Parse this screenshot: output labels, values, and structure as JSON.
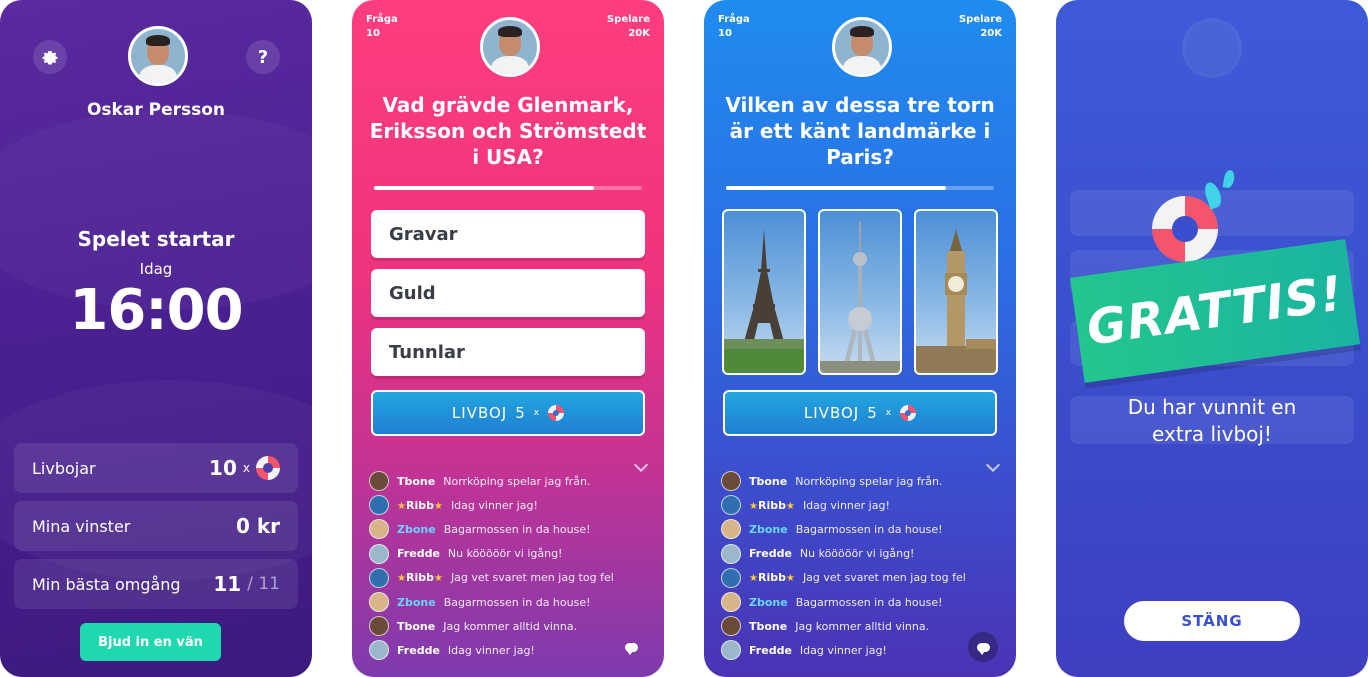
{
  "screen1": {
    "user_name": "Oskar Persson",
    "settings_icon": "gear-icon",
    "help_label": "?",
    "start_label": "Spelet startar",
    "day_label": "Idag",
    "time": "16:00",
    "stats": [
      {
        "label": "Livbojar",
        "value": "10",
        "suffix": "x"
      },
      {
        "label": "Mina vinster",
        "value": "0 kr"
      },
      {
        "label": "Min bästa omgång",
        "value": "11",
        "total": "/ 11"
      }
    ],
    "invite_label": "Bjud in en vän"
  },
  "quiz": {
    "question_label": "Fråga",
    "question_number": "10",
    "players_label": "Spelare",
    "players_count": "20K",
    "lifeline_label": "LIVBOJ",
    "lifeline_count": "5",
    "lifeline_x": "x"
  },
  "screen2": {
    "question": "Vad grävde Glenmark, Eriksson och Strömstedt i USA?",
    "progress": 0.82,
    "answers": [
      "Gravar",
      "Guld",
      "Tunnlar"
    ]
  },
  "screen3": {
    "question": "Vilken av dessa tre torn är ett känt landmärke i Paris?",
    "progress": 0.82,
    "photos": [
      "eiffel-tower-photo",
      "oriental-pearl-tower-photo",
      "big-ben-photo"
    ]
  },
  "chat": [
    {
      "user": "Tbone",
      "msg": "Norrköping spelar jag från.",
      "style": "plain",
      "color": "#6b4a3a"
    },
    {
      "user": "Ribb",
      "msg": "Idag vinner jag!",
      "style": "star",
      "color": "#2f6fb0"
    },
    {
      "user": "Zbone",
      "msg": "Bagarmossen in da house!",
      "style": "c",
      "color": "#d8b48a"
    },
    {
      "user": "Fredde",
      "msg": "Nu kööööör vi igång!",
      "style": "plain",
      "color": "#9bb7c9"
    },
    {
      "user": "Ribb",
      "msg": "Jag vet svaret men jag tog fel",
      "style": "star",
      "color": "#2f6fb0"
    },
    {
      "user": "Zbone",
      "msg": "Bagarmossen in da house!",
      "style": "c",
      "color": "#d8b48a"
    },
    {
      "user": "Tbone",
      "msg": "Jag kommer alltid vinna.",
      "style": "plain",
      "color": "#6b4a3a"
    },
    {
      "user": "Fredde",
      "msg": "Idag vinner jag!",
      "style": "plain",
      "color": "#9bb7c9"
    }
  ],
  "screen4": {
    "banner": "GRATTIS!",
    "message_line1": "Du har vunnit en",
    "message_line2": "extra livboj!",
    "close_label": "STÄNG"
  }
}
